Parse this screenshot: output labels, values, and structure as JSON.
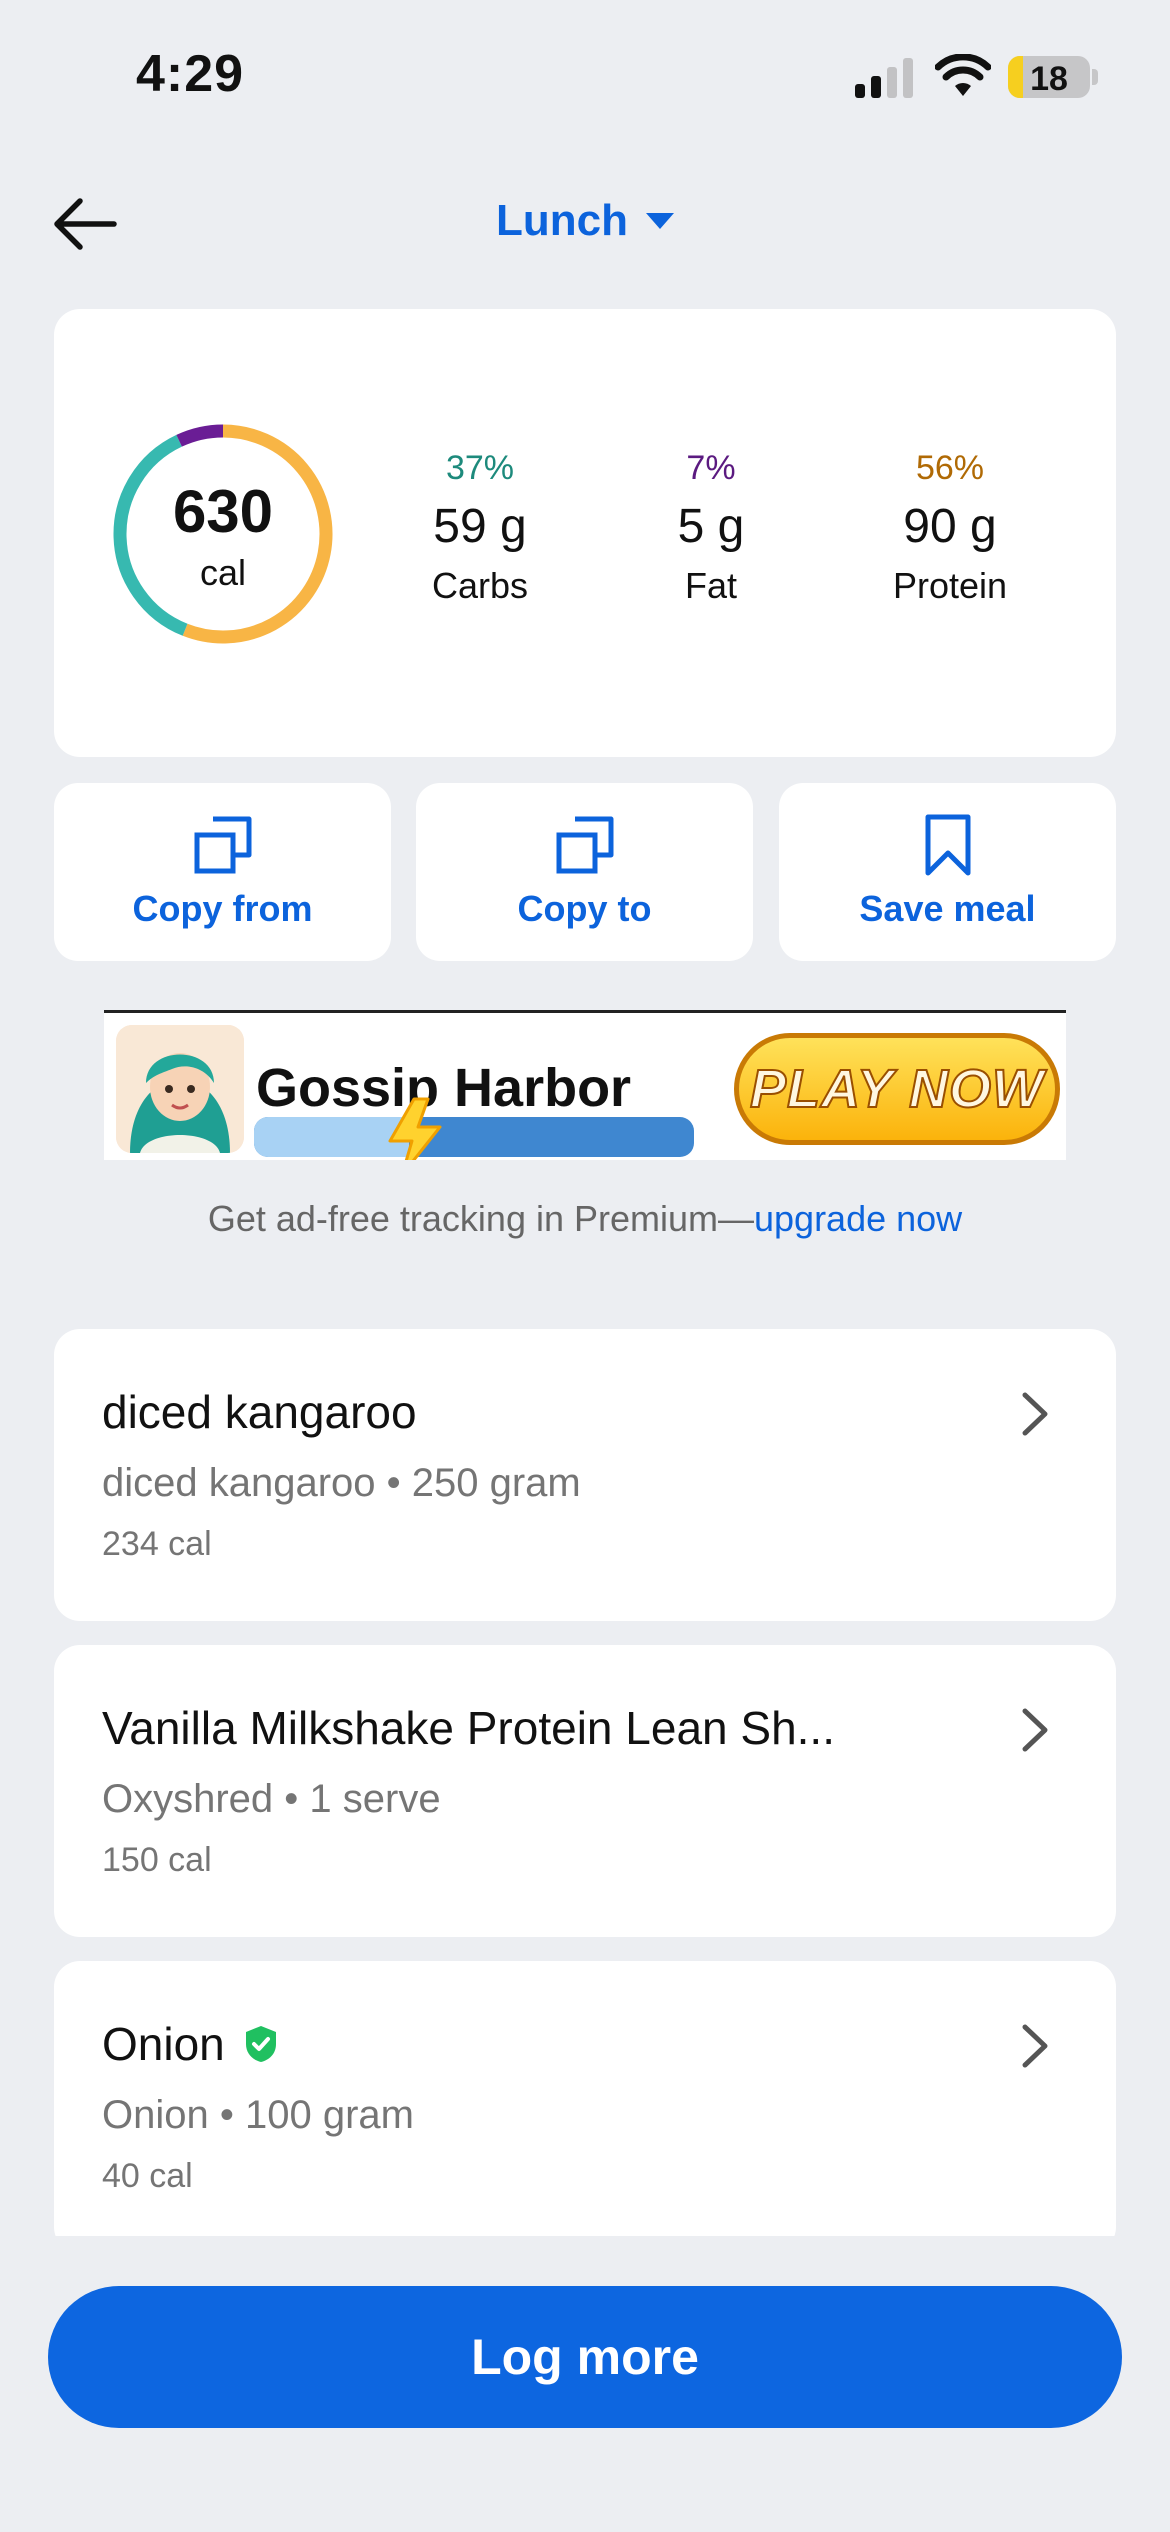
{
  "status_bar": {
    "time": "4:29",
    "battery": "18",
    "battery_level": 0.18,
    "icons": [
      "signal-icon",
      "wifi-icon",
      "battery-icon"
    ]
  },
  "header": {
    "back_icon": "arrow-left-icon",
    "title": "Lunch",
    "dropdown_icon": "caret-down-icon"
  },
  "summary": {
    "calories": "630",
    "calories_unit": "cal",
    "macros": [
      {
        "key": "carbs",
        "percent": "37%",
        "grams": "59 g",
        "label": "Carbs",
        "color": "#1d8a7c",
        "ring_color": "#37b9b0"
      },
      {
        "key": "fat",
        "percent": "7%",
        "grams": "5 g",
        "label": "Fat",
        "color": "#5b1a80",
        "ring_color": "#6a1d95"
      },
      {
        "key": "protein",
        "percent": "56%",
        "grams": "90 g",
        "label": "Protein",
        "color": "#b06a05",
        "ring_color": "#f8b545"
      }
    ]
  },
  "actions": [
    {
      "label": "Copy from",
      "icon": "copy-icon"
    },
    {
      "label": "Copy to",
      "icon": "copy-icon"
    },
    {
      "label": "Save meal",
      "icon": "bookmark-icon"
    }
  ],
  "ad": {
    "title": "Gossip Harbor",
    "cta": "PLAY NOW"
  },
  "premium": {
    "text": "Get ad-free tracking in Premium—",
    "link": "upgrade now"
  },
  "foods": [
    {
      "name": "diced kangaroo",
      "detail": "diced kangaroo • 250 gram",
      "calories": "234 cal",
      "verified": false
    },
    {
      "name": "Vanilla Milkshake Protein Lean Sh...",
      "detail": "Oxyshred • 1 serve",
      "calories": "150 cal",
      "verified": false
    },
    {
      "name": "Onion",
      "detail": "Onion • 100 gram",
      "calories": "40 cal",
      "verified": true
    }
  ],
  "footer": {
    "button": "Log more"
  },
  "colors": {
    "accent": "#0c63dc",
    "background": "#eceef2",
    "verified": "#20c060"
  }
}
